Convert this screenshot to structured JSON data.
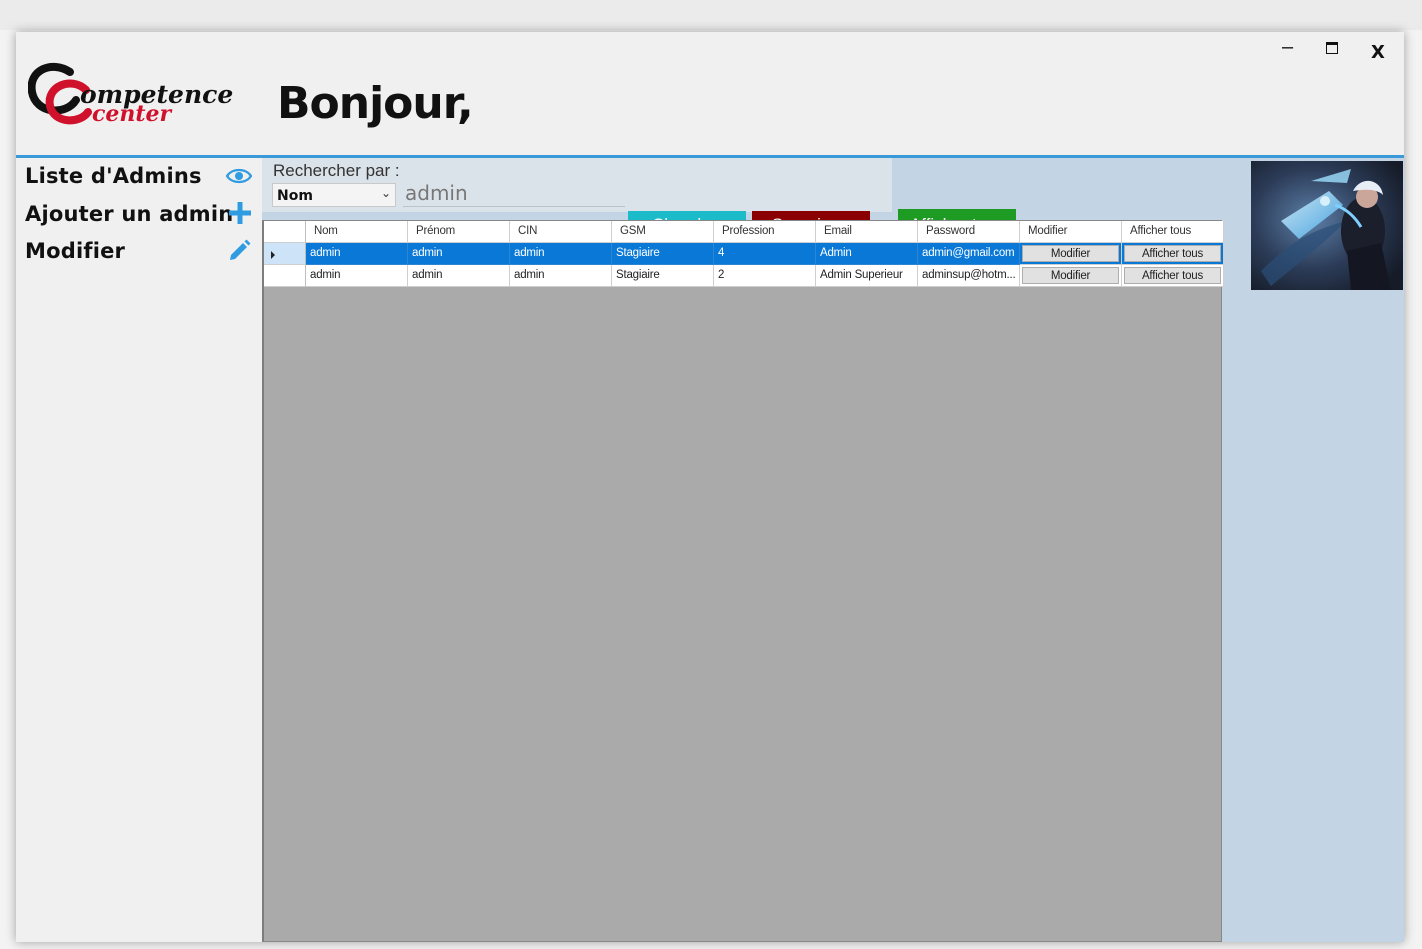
{
  "header": {
    "logo_line1": "ompetence",
    "logo_line2": "center",
    "greeting": "Bonjour,",
    "window_minimize": "–",
    "window_close": "X"
  },
  "sidebar": {
    "items": [
      {
        "label": "Liste  d'Admins",
        "icon": "eye-icon"
      },
      {
        "label": "Ajouter un admin",
        "icon": "plus-icon"
      },
      {
        "label": "Modifier",
        "icon": "pencil-icon"
      }
    ]
  },
  "search": {
    "label": "Rechercher par :",
    "field_selected": "Nom",
    "query_value": "admin",
    "search_button": "Chercher",
    "delete_button": "Supprimer",
    "show_all_button": "Afficher tous"
  },
  "grid": {
    "columns": [
      "Nom",
      "Prénom",
      "CIN",
      "GSM",
      "Profession",
      "Email",
      "Password",
      "Modifier",
      "Afficher tous"
    ],
    "rows": [
      {
        "selected": true,
        "cells": [
          "admin",
          "admin",
          "admin",
          "Stagiaire",
          "4",
          "Admin",
          "admin@gmail.com"
        ],
        "modify": "Modifier",
        "show_all": "Afficher tous"
      },
      {
        "selected": false,
        "cells": [
          "admin",
          "admin",
          "admin",
          "Stagiaire",
          "2",
          "Admin Superieur",
          "adminsup@hotm..."
        ],
        "modify": "Modifier",
        "show_all": "Afficher tous"
      }
    ]
  },
  "colors": {
    "accent": "#3a9ad9",
    "search_button": "#1cbbc9",
    "delete_button": "#8b0000",
    "show_all_button": "#1e9b22",
    "selection": "#0a78d7"
  }
}
